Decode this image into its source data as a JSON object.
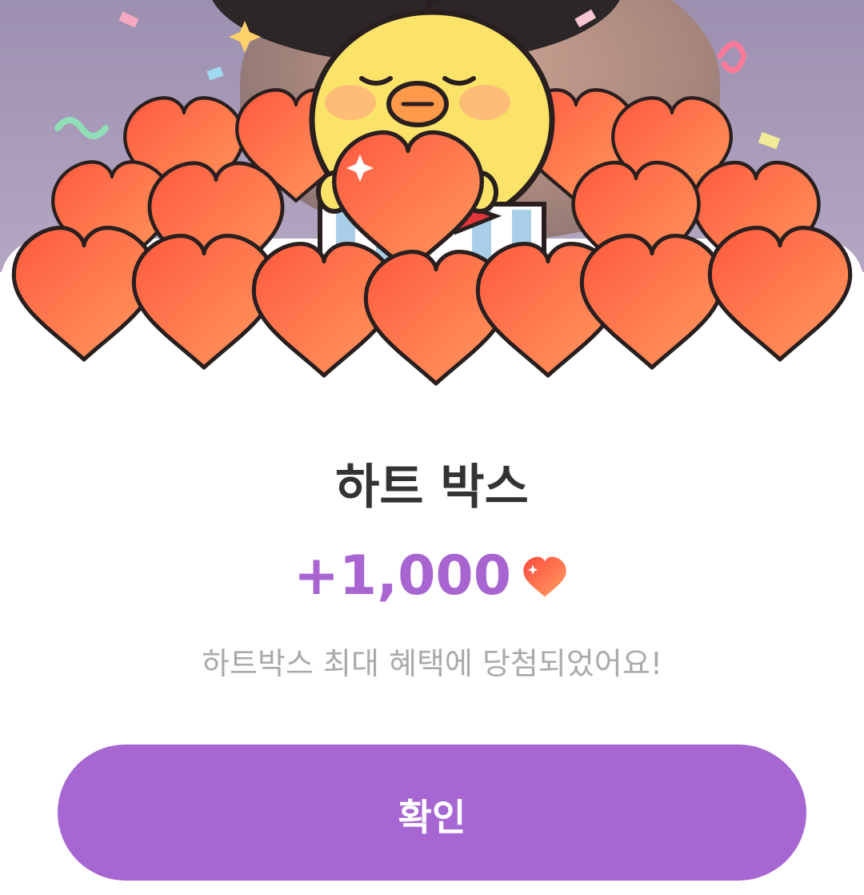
{
  "dialog": {
    "title": "하트 박스",
    "reward_amount": "+1,000",
    "description": "하트박스 최대 혜택에 당첨되었어요!",
    "confirm_label": "확인"
  },
  "icons": {
    "reward": "heart-icon",
    "illustration": "chick-holding-heart-box-illustration"
  },
  "colors": {
    "accent": "#a767d3",
    "amount_text": "#a864d0",
    "title_text": "#333333",
    "description_text": "#aaaaaa",
    "heart": "#ff6a45"
  }
}
